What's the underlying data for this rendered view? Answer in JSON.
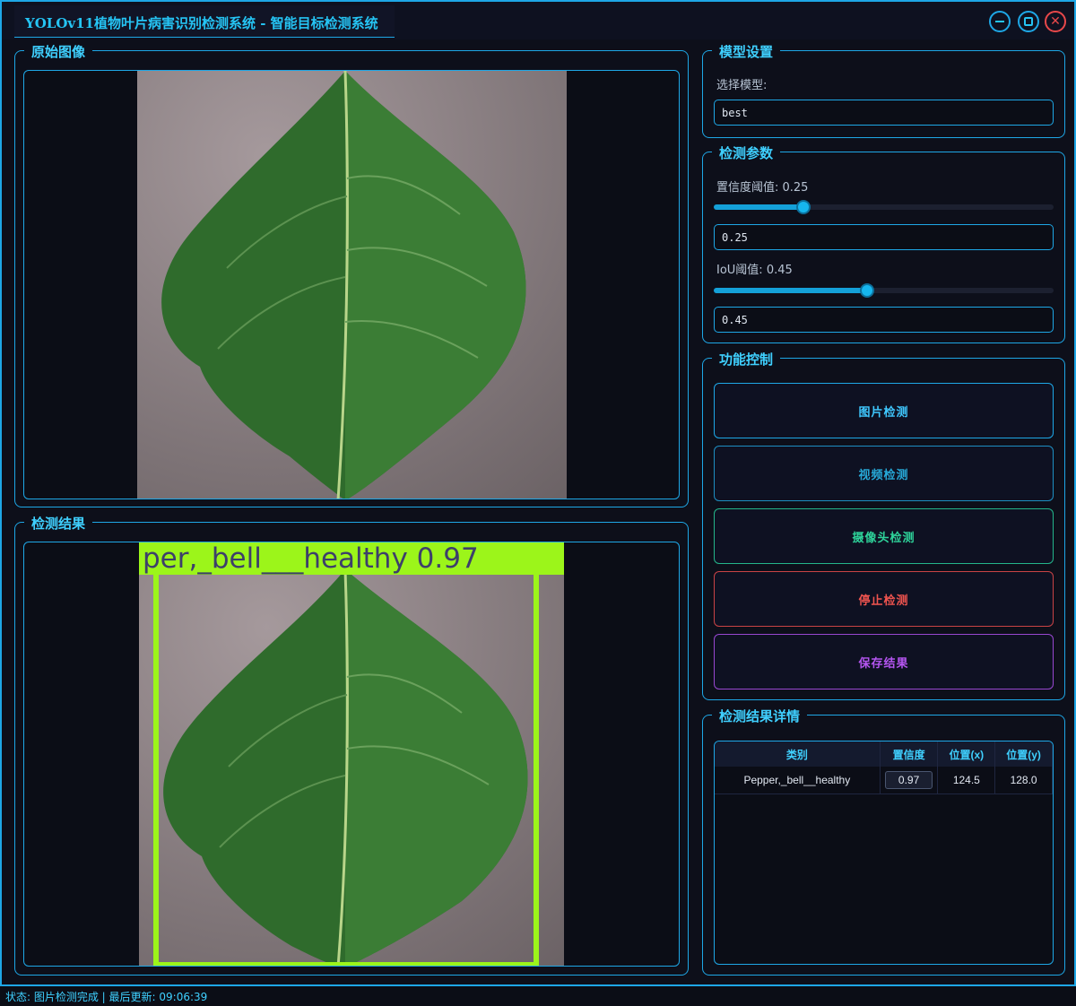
{
  "window": {
    "title": "YOLOv11植物叶片病害识别检测系统 - 智能目标检测系统"
  },
  "panels": {
    "original_title": "原始图像",
    "result_title": "检测结果",
    "model_title": "模型设置",
    "params_title": "检测参数",
    "controls_title": "功能控制",
    "details_title": "检测结果详情"
  },
  "model": {
    "select_label": "选择模型:",
    "selected": "best"
  },
  "params": {
    "confidence_label": "置信度阈值: 0.25",
    "confidence_value": "0.25",
    "confidence_fraction": 0.25,
    "iou_label": "IoU阈值: 0.45",
    "iou_value": "0.45",
    "iou_fraction": 0.45
  },
  "controls": {
    "image_detect": "图片检测",
    "video_detect": "视频检测",
    "camera_detect": "摄像头检测",
    "stop_detect": "停止检测",
    "save_results": "保存结果"
  },
  "colors": {
    "accent": "#1ea7e6",
    "stop": "#e8484a",
    "camera": "#2ed39a",
    "save": "#b455f0",
    "bbox": "#9cf51a"
  },
  "detection": {
    "box_label": "per,_bell___healthy 0.97"
  },
  "table": {
    "headers": [
      "类别",
      "置信度",
      "位置(x)",
      "位置(y)"
    ],
    "rows": [
      [
        "Pepper,_bell__healthy",
        "0.97",
        "124.5",
        "128.0"
      ]
    ]
  },
  "status": {
    "text": "状态: 图片检测完成 | 最后更新: 09:06:39"
  }
}
